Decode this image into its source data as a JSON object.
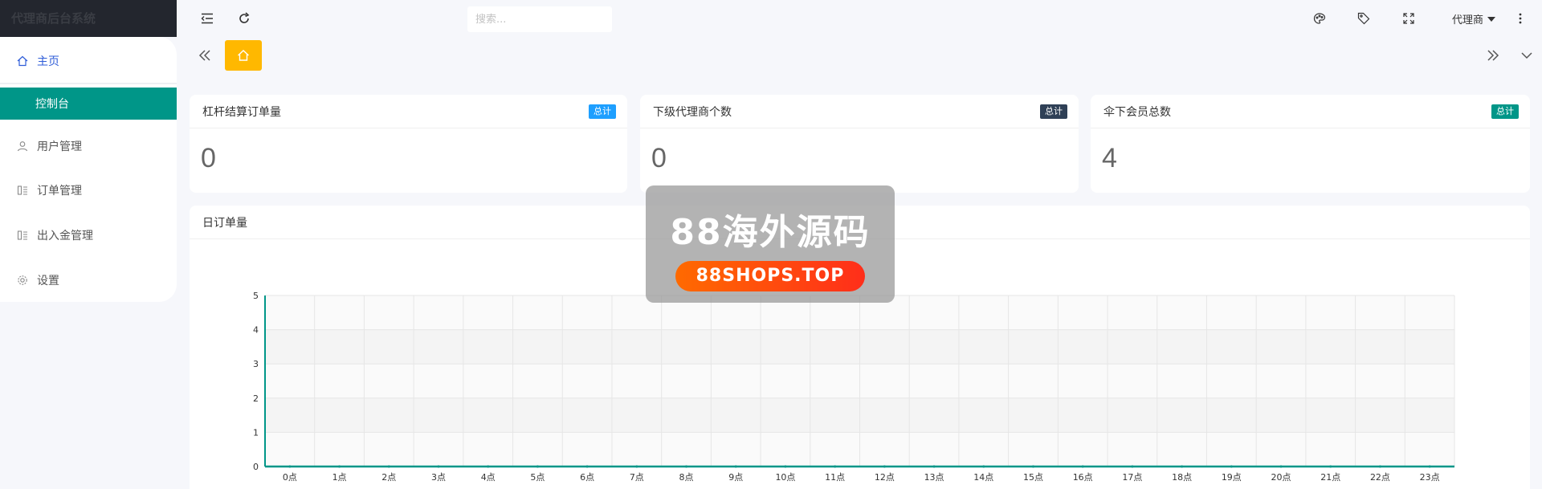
{
  "app": {
    "title": "代理商后台系统"
  },
  "sidebar": {
    "items": [
      {
        "label": "主页",
        "icon": "home-icon"
      },
      {
        "label": "控制台"
      },
      {
        "label": "用户管理",
        "icon": "user-icon"
      },
      {
        "label": "订单管理",
        "icon": "list-icon"
      },
      {
        "label": "出入金管理",
        "icon": "list-icon"
      },
      {
        "label": "设置",
        "icon": "gear-icon"
      }
    ]
  },
  "topbar": {
    "search_placeholder": "搜索...",
    "user_label": "代理商"
  },
  "cards": [
    {
      "title": "杠杆结算订单量",
      "badge": "总计",
      "badge_color": "#1e9fff",
      "value": "0"
    },
    {
      "title": "下级代理商个数",
      "badge": "总计",
      "badge_color": "#2f4056",
      "value": "0"
    },
    {
      "title": "伞下会员总数",
      "badge": "总计",
      "badge_color": "#009688",
      "value": "4"
    }
  ],
  "chart_section": {
    "title": "日订单量"
  },
  "watermark": {
    "title": "88海外源码",
    "subtitle": "88SHOPS.TOP"
  },
  "chart_data": {
    "type": "line",
    "categories": [
      "0点",
      "1点",
      "2点",
      "3点",
      "4点",
      "5点",
      "6点",
      "7点",
      "8点",
      "9点",
      "10点",
      "11点",
      "12点",
      "13点",
      "14点",
      "15点",
      "16点",
      "17点",
      "18点",
      "19点",
      "20点",
      "21点",
      "22点",
      "23点"
    ],
    "series": [
      {
        "values": [
          0,
          0,
          0,
          0,
          0,
          0,
          0,
          0,
          0,
          0,
          0,
          0,
          0,
          0,
          0,
          0,
          0,
          0,
          0,
          0,
          0,
          0,
          0,
          0
        ]
      }
    ],
    "yticks": [
      "0",
      "1",
      "2",
      "3",
      "4",
      "5"
    ],
    "ylim": [
      0,
      5
    ],
    "line_color": "#009688",
    "grid": true
  }
}
